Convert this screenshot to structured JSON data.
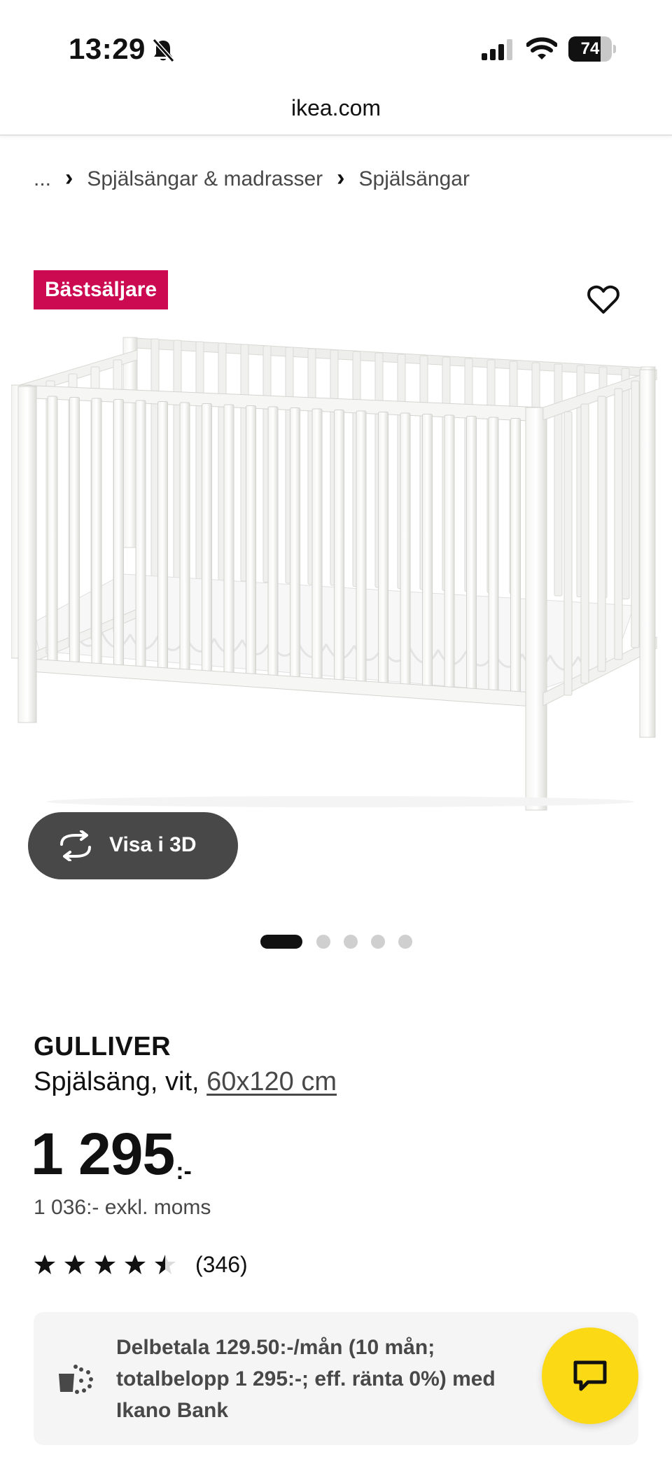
{
  "status_bar": {
    "time": "13:29",
    "battery_level": 74,
    "battery_label": "74",
    "icons": [
      "bell-slash-icon",
      "cellular-signal-icon",
      "wifi-icon",
      "battery-icon"
    ]
  },
  "browser": {
    "url": "ikea.com"
  },
  "breadcrumb": {
    "items": [
      "...",
      "Spjälsängar & madrasser",
      "Spjälsängar"
    ],
    "separator": "›"
  },
  "gallery": {
    "badge": "Bästsäljare",
    "view_3d_label": "Visa i 3D",
    "slide_count": 5,
    "active_slide": 1,
    "icons": [
      "heart-icon",
      "rotate-3d-icon"
    ]
  },
  "product": {
    "name": "GULLIVER",
    "description": "Spjälsäng, vit, ",
    "size": "60x120 cm",
    "price": "1 295",
    "price_suffix": ":-",
    "price_ex_vat": "1 036:- exkl. moms",
    "rating": 4.5,
    "rating_max": 5,
    "review_count": "(346)"
  },
  "finance": {
    "text": "Delbetala 129.50:-/mån (10 mån; totalbelopp 1 295:-; eff. ränta 0%) med Ikano Bank",
    "icon": "wallet-coins-icon"
  },
  "chat": {
    "icon": "chat-bubble-icon"
  },
  "colors": {
    "badge": "#cc0a52",
    "chat_button": "#fbd914",
    "dark_button": "#484848",
    "finance_bg": "#f5f5f5"
  }
}
